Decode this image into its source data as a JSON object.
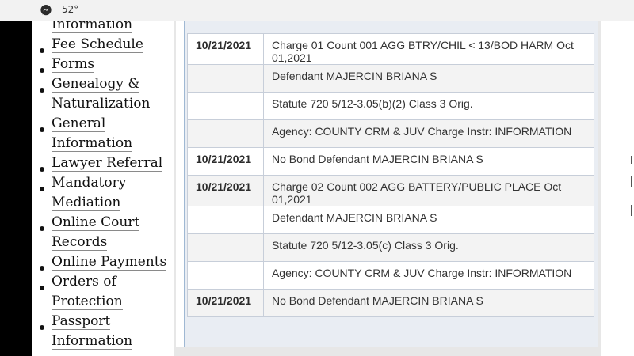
{
  "status_bar": {
    "app_icon": "messenger-icon",
    "temperature": "52°"
  },
  "sidebar": {
    "items": [
      {
        "label": "Information"
      },
      {
        "label": "Fee Schedule"
      },
      {
        "label": "Forms"
      },
      {
        "label": "Genealogy & Naturalization"
      },
      {
        "label": "General Information"
      },
      {
        "label": "Lawyer Referral"
      },
      {
        "label": "Mandatory Mediation"
      },
      {
        "label": "Online Court Records"
      },
      {
        "label": "Online Payments"
      },
      {
        "label": "Orders of Protection"
      },
      {
        "label": "Passport Information"
      }
    ]
  },
  "docket": {
    "rows": [
      {
        "date": "10/21/2021",
        "text": "Charge 01 Count 001 AGG BTRY/CHIL < 13/BOD HARM Oct 01,2021"
      },
      {
        "date": "",
        "text": "Defendant MAJERCIN BRIANA S"
      },
      {
        "date": "",
        "text": "Statute 720 5/12-3.05(b)(2) Class 3 Orig."
      },
      {
        "date": "",
        "text": "Agency: COUNTY CRM & JUV Charge Instr: INFORMATION"
      },
      {
        "date": "10/21/2021",
        "text": "No Bond Defendant MAJERCIN BRIANA S"
      },
      {
        "date": "10/21/2021",
        "text": "Charge 02 Count 002 AGG BATTERY/PUBLIC PLACE Oct 01,2021"
      },
      {
        "date": "",
        "text": "Defendant MAJERCIN BRIANA S"
      },
      {
        "date": "",
        "text": "Statute 720 5/12-3.05(c) Class 3 Orig."
      },
      {
        "date": "",
        "text": "Agency: COUNTY CRM & JUV Charge Instr: INFORMATION"
      },
      {
        "date": "10/21/2021",
        "text": "No Bond Defendant MAJERCIN BRIANA S"
      }
    ]
  }
}
